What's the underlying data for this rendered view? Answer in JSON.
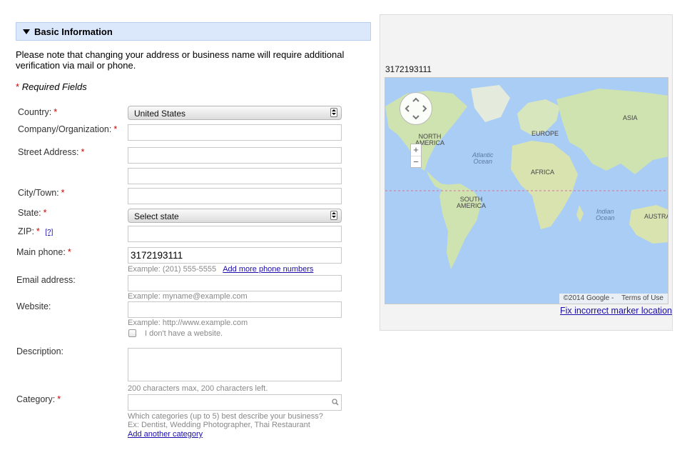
{
  "header": {
    "title": "Basic Information"
  },
  "note": "Please note that changing your address or business name will require additional verification via mail or phone.",
  "required_fields": {
    "star": "*",
    "label": "Required Fields"
  },
  "form": {
    "country": {
      "label": "Country:",
      "star": "*",
      "value": "United States"
    },
    "company": {
      "label": "Company/Organization:",
      "star": "*",
      "value": ""
    },
    "street": {
      "label": "Street Address:",
      "star": "*",
      "value1": "",
      "value2": ""
    },
    "city": {
      "label": "City/Town:",
      "star": "*",
      "value": ""
    },
    "state": {
      "label": "State:",
      "star": "*",
      "value": "Select state"
    },
    "zip": {
      "label": "ZIP:",
      "star": "*",
      "help": "[?]",
      "value": ""
    },
    "phone": {
      "label": "Main phone:",
      "star": "*",
      "value": "3172193111",
      "hint": "Example: (201) 555-5555",
      "add_link": "Add more phone numbers"
    },
    "email": {
      "label": "Email address:",
      "value": "",
      "hint": "Example: myname@example.com"
    },
    "website": {
      "label": "Website:",
      "value": "",
      "hint": "Example: http://www.example.com",
      "no_website": "I don't have a website."
    },
    "description": {
      "label": "Description:",
      "value": "",
      "hint": "200 characters max, 200 characters left."
    },
    "category": {
      "label": "Category:",
      "star": "*",
      "value": "",
      "hint1": "Which categories (up to 5) best describe your business?",
      "hint2": "Ex: Dentist, Wedding Photographer, Thai Restaurant",
      "add_link": "Add another category"
    }
  },
  "map": {
    "phone_text": "3172193111",
    "labels": {
      "asia": "ASIA",
      "north_america": "NORTH\nAMERICA",
      "europe": "EUROPE",
      "atlantic": "Atlantic\nOcean",
      "africa": "AFRICA",
      "south_america": "SOUTH\nAMERICA",
      "indian": "Indian\nOcean",
      "australia": "AUSTRA"
    },
    "zoom_in": "+",
    "zoom_out": "−",
    "copyright": "©2014 Google -",
    "terms": "Terms of Use",
    "fix_link": "Fix incorrect marker location"
  },
  "colors": {
    "header_bg": "#dbe7fb",
    "required_star": "#cc0000",
    "link": "#1a0dab",
    "water": "#a9cdf5",
    "land": "#cfe3b0"
  }
}
